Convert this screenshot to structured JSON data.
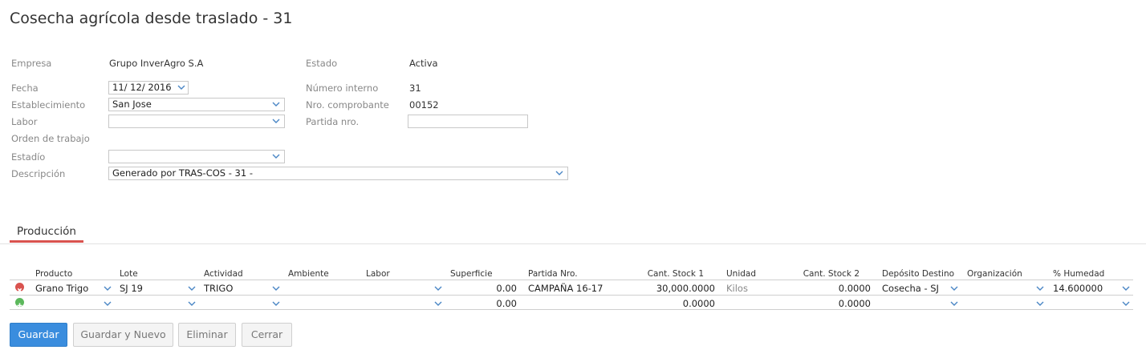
{
  "page_title": "Cosecha agrícola desde traslado - 31",
  "form": {
    "empresa_label": "Empresa",
    "empresa_value": "Grupo InverAgro S.A",
    "estado_label": "Estado",
    "estado_value": "Activa",
    "fecha_label": "Fecha",
    "fecha_value": "11/ 12/ 2016",
    "numero_interno_label": "Número interno",
    "numero_interno_value": "31",
    "establecimiento_label": "Establecimiento",
    "establecimiento_value": "San Jose",
    "nro_comprobante_label": "Nro. comprobante",
    "nro_comprobante_value": "00152",
    "labor_label": "Labor",
    "labor_value": "",
    "partida_label": "Partida nro.",
    "partida_value": "",
    "orden_label": "Orden de trabajo",
    "estadio_label": "Estadío",
    "estadio_value": "",
    "descripcion_label": "Descripción",
    "descripcion_value": "Generado por TRAS-COS - 31 -"
  },
  "tabs": [
    {
      "label": "Producción",
      "active": true
    }
  ],
  "grid": {
    "headers": [
      "Producto",
      "Lote",
      "Actividad",
      "Ambiente",
      "Labor",
      "Superficie",
      "Partida Nro.",
      "Cant. Stock 1",
      "Unidad",
      "Cant. Stock 2",
      "Depósito Destino",
      "Organización",
      "% Humedad"
    ],
    "rows": [
      [
        "Grano Trigo",
        "SJ 19",
        "TRIGO",
        "",
        "",
        "0.00",
        "CAMPAÑA 16-17",
        "30,000.0000",
        "Kilos",
        "0.0000",
        "Cosecha - SJ",
        "",
        "14.600000"
      ],
      [
        "",
        "",
        "",
        "",
        "",
        "0.00",
        "",
        "0.0000",
        "",
        "0.0000",
        "",
        "",
        ""
      ]
    ],
    "row_icons": [
      "remove-icon",
      "add-icon"
    ]
  },
  "buttons": {
    "guardar": "Guardar",
    "guardar_nuevo": "Guardar y Nuevo",
    "eliminar": "Eliminar",
    "cerrar": "Cerrar"
  },
  "colors": {
    "primary": "#3a8dde",
    "tab_accent": "#d9534f",
    "remove": "#d9534f",
    "add": "#5cb85c",
    "chevron": "#4a86c5"
  }
}
